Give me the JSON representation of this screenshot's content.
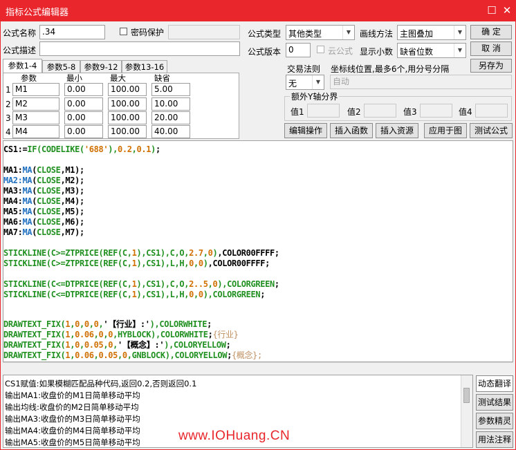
{
  "window": {
    "title": "指标公式编辑器"
  },
  "form": {
    "name_label": "公式名称",
    "name_value": ".34",
    "password_label": "密码保护",
    "desc_label": "公式描述",
    "desc_value": "",
    "type_label": "公式类型",
    "type_value": "其他类型",
    "draw_label": "画线方法",
    "draw_value": "主图叠加",
    "version_label": "公式版本",
    "version_value": "0",
    "cloud_label": "云公式",
    "decimals_label": "显示小数",
    "decimals_value": "缺省位数",
    "trade_label": "交易法则",
    "trade_value": "无",
    "coord_hint": "坐标线位置,最多6个,用分号分隔",
    "coord_value": "自动",
    "yaxis_label": "额外Y轴分界",
    "yaxis": [
      "值1",
      "值2",
      "值3",
      "值4"
    ]
  },
  "buttons": {
    "ok": "确  定",
    "cancel": "取  消",
    "save_as": "另存为",
    "edit": "编辑操作",
    "insert_func": "插入函数",
    "insert_res": "插入资源",
    "apply": "应用于图",
    "test": "测试公式",
    "dyn_translate": "动态翻译",
    "test_result": "测试结果",
    "param_tune": "参数精灵",
    "usage_note": "用法注释"
  },
  "tabs": [
    "参数1-4",
    "参数5-8",
    "参数9-12",
    "参数13-16"
  ],
  "params": {
    "headers": [
      "参数",
      "最小",
      "最大",
      "缺省"
    ],
    "rows": [
      {
        "n": "1",
        "name": "M1",
        "min": "0.00",
        "max": "100.00",
        "def": "5.00"
      },
      {
        "n": "2",
        "name": "M2",
        "min": "0.00",
        "max": "100.00",
        "def": "10.00"
      },
      {
        "n": "3",
        "name": "M3",
        "min": "0.00",
        "max": "100.00",
        "def": "20.00"
      },
      {
        "n": "4",
        "name": "M4",
        "min": "0.00",
        "max": "100.00",
        "def": "40.00"
      }
    ]
  },
  "code_lines": [
    "CS1:=IF(CODELIKE('688'),0.2,0.1);",
    "",
    "MA1:MA(CLOSE,M1);",
    "MA2:MA(CLOSE,M2);",
    "MA3:MA(CLOSE,M3);",
    "MA4:MA(CLOSE,M4);",
    "MA5:MA(CLOSE,M5);",
    "MA6:MA(CLOSE,M6);",
    "MA7:MA(CLOSE,M7);",
    "",
    "STICKLINE(C>=ZTPRICE(REF(C,1),CS1),C,O,2.7,0),COLOR00FFFF;",
    "STICKLINE(C>=ZTPRICE(REF(C,1),CS1),L,H,0,0),COLOR00FFFF;",
    "",
    "STICKLINE(C<=DTPRICE(REF(C,1),CS1),C,O,2..5,0),COLORGREEN;",
    "STICKLINE(C<=DTPRICE(REF(C,1),CS1),L,H,0,0),COLORGREEN;",
    "",
    "",
    "DRAWTEXT_FIX(1,0,0,0,'【行业】:'),COLORWHITE;",
    "DRAWTEXT_FIX(1,0.06,0,0,HYBLOCK),COLORWHITE;{行业}",
    "DRAWTEXT_FIX(1,0,0.05,0,'【概念】:'),COLORYELLOW;",
    "DRAWTEXT_FIX(1,0.06,0.05,0,GNBLOCK),COLORYELLOW;{概念};"
  ],
  "notes": [
    "CS1赋值:如果模糊匹配品种代码,返回0.2,否则返回0.1",
    "输出MA1:收盘价的M1日简单移动平均",
    "输出均线:收盘价的M2日简单移动平均",
    "输出MA3:收盘价的M3日简单移动平均",
    "输出MA4:收盘价的M4日简单移动平均",
    "输出MA5:收盘价的M5日简单移动平均"
  ],
  "watermark": "www.IOHuang.CN",
  "colors": {
    "title_bar": "#e8262c",
    "code_green": "#209020",
    "code_orange": "#d07000",
    "code_blue": "#2070c0"
  }
}
